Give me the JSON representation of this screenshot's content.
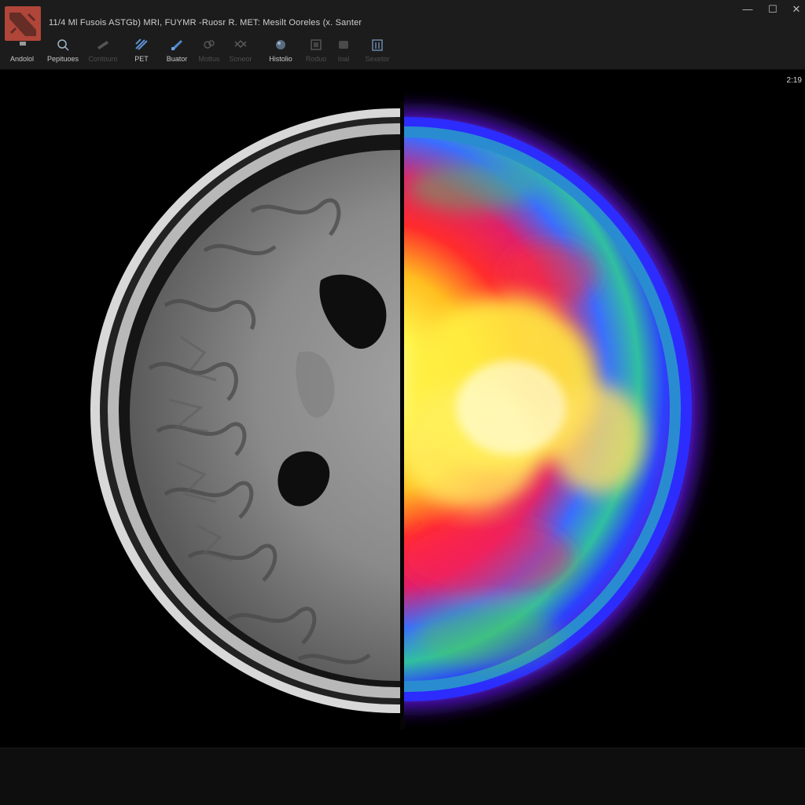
{
  "window": {
    "title": "11/4 Ml Fusois ASTGb) MRI, FUYMR -Ruosr R. MET: Mesilt Ooreles (x. Santer",
    "controls": {
      "minimize": "—",
      "maximize": "☐",
      "close": "✕"
    },
    "icon": "app-logo"
  },
  "toolbar": {
    "items": [
      {
        "label": "Andolol",
        "icon": "pointer-icon",
        "dim": false
      },
      {
        "label": "Pepituoes",
        "icon": "magnifier-icon",
        "dim": false
      },
      {
        "label": "Contouro",
        "icon": "ruler-icon",
        "dim": true
      },
      {
        "label": "PET",
        "icon": "pet-icon",
        "dim": false
      },
      {
        "label": "Buator",
        "icon": "brush-icon",
        "dim": false
      },
      {
        "label": "Mottus",
        "icon": "link-icon",
        "dim": true
      },
      {
        "label": "Soneor",
        "icon": "grid-icon",
        "dim": true
      },
      {
        "label": "Histolio",
        "icon": "sphere-icon",
        "dim": false
      },
      {
        "label": "Roduo",
        "icon": "layers-icon",
        "dim": true
      },
      {
        "label": "Ioal",
        "icon": "box-icon",
        "dim": true
      },
      {
        "label": "Sexetor",
        "icon": "building-icon",
        "dim": true
      }
    ]
  },
  "viewer": {
    "readout": "2:19",
    "left_panel": "mri-grayscale",
    "right_panel": "pet-colormap",
    "colors": {
      "pet_hot": "#ffff40",
      "pet_mid": "#ff3030",
      "pet_cool": "#3040ff",
      "pet_rim": "#6a20ff"
    }
  }
}
